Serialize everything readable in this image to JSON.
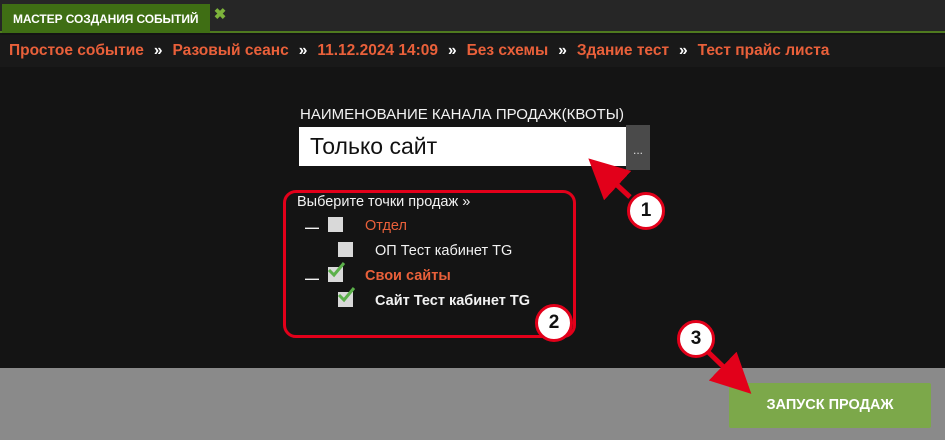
{
  "tab": {
    "title": "МАСТЕР СОЗДАНИЯ СОБЫТИЙ",
    "close_glyph": "✖"
  },
  "breadcrumb": {
    "separator": "»",
    "items": [
      "Простое событие",
      "Разовый сеанс",
      "11.12.2024 14:09",
      "Без схемы",
      "Здание тест",
      "Тест прайс листа"
    ]
  },
  "channel": {
    "label": "НАИМЕНОВАНИЕ КАНАЛА ПРОДАЖ(КВОТЫ)",
    "value": "Только сайт",
    "more_button": "..."
  },
  "points": {
    "title": "Выберите точки продаж »",
    "groups": [
      {
        "label": "Отдел",
        "checked": false,
        "children": [
          {
            "label": "ОП Тест кабинет TG",
            "checked": false
          }
        ]
      },
      {
        "label": "Свои сайты",
        "checked": true,
        "children": [
          {
            "label": "Сайт Тест кабинет TG",
            "checked": true
          }
        ]
      }
    ]
  },
  "launch_button": "ЗАПУСК ПРОДАЖ",
  "annotations": [
    "1",
    "2",
    "3"
  ],
  "colors": {
    "accent_orange": "#e9603a",
    "tab_green": "#3f6e14",
    "button_green": "#7ca84a",
    "annotation_red": "#e2001a",
    "check_green": "#5bb04a"
  },
  "icons": {
    "collapse": "minus-icon",
    "check": "checkmark-icon",
    "close": "close-icon"
  }
}
